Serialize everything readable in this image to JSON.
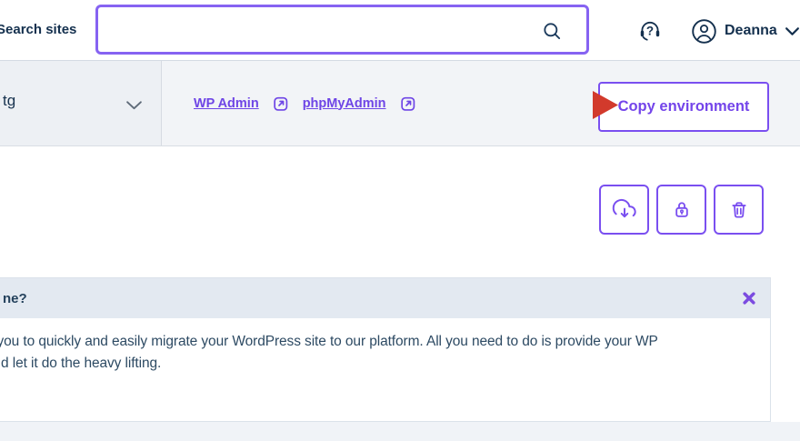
{
  "topbar": {
    "search_label": "Search sites",
    "search_value": "",
    "user_name": "Deanna"
  },
  "envbar": {
    "env_name": "tg",
    "links": [
      {
        "label": "WP Admin",
        "icon": "external-link-icon"
      },
      {
        "label": "phpMyAdmin",
        "icon": "external-link-icon"
      }
    ],
    "copy_button_label": "Copy environment"
  },
  "action_buttons": [
    {
      "name": "download-backup",
      "icon": "cloud-download-icon"
    },
    {
      "name": "lock-environment",
      "icon": "lock-icon"
    },
    {
      "name": "delete-environment",
      "icon": "trash-icon"
    }
  ],
  "banner": {
    "title_visible": "ne?",
    "body_lines": [
      "you to quickly and easily migrate your WordPress site to our platform. All you need to do is provide your WP",
      "d let it do the heavy lifting."
    ]
  },
  "cursor": {
    "type": "red-triangle-pointer"
  },
  "colors": {
    "accent_purple": "#7a4ff0",
    "link_purple": "#6e45e6",
    "navy_text": "#14304e",
    "body_text": "#2d4a63",
    "red_cursor": "#d23a2c",
    "banner_header_bg": "#e3e9f1",
    "envbar_bg": "#f2f4f7",
    "envbar_left_bg": "#edf0f4"
  }
}
